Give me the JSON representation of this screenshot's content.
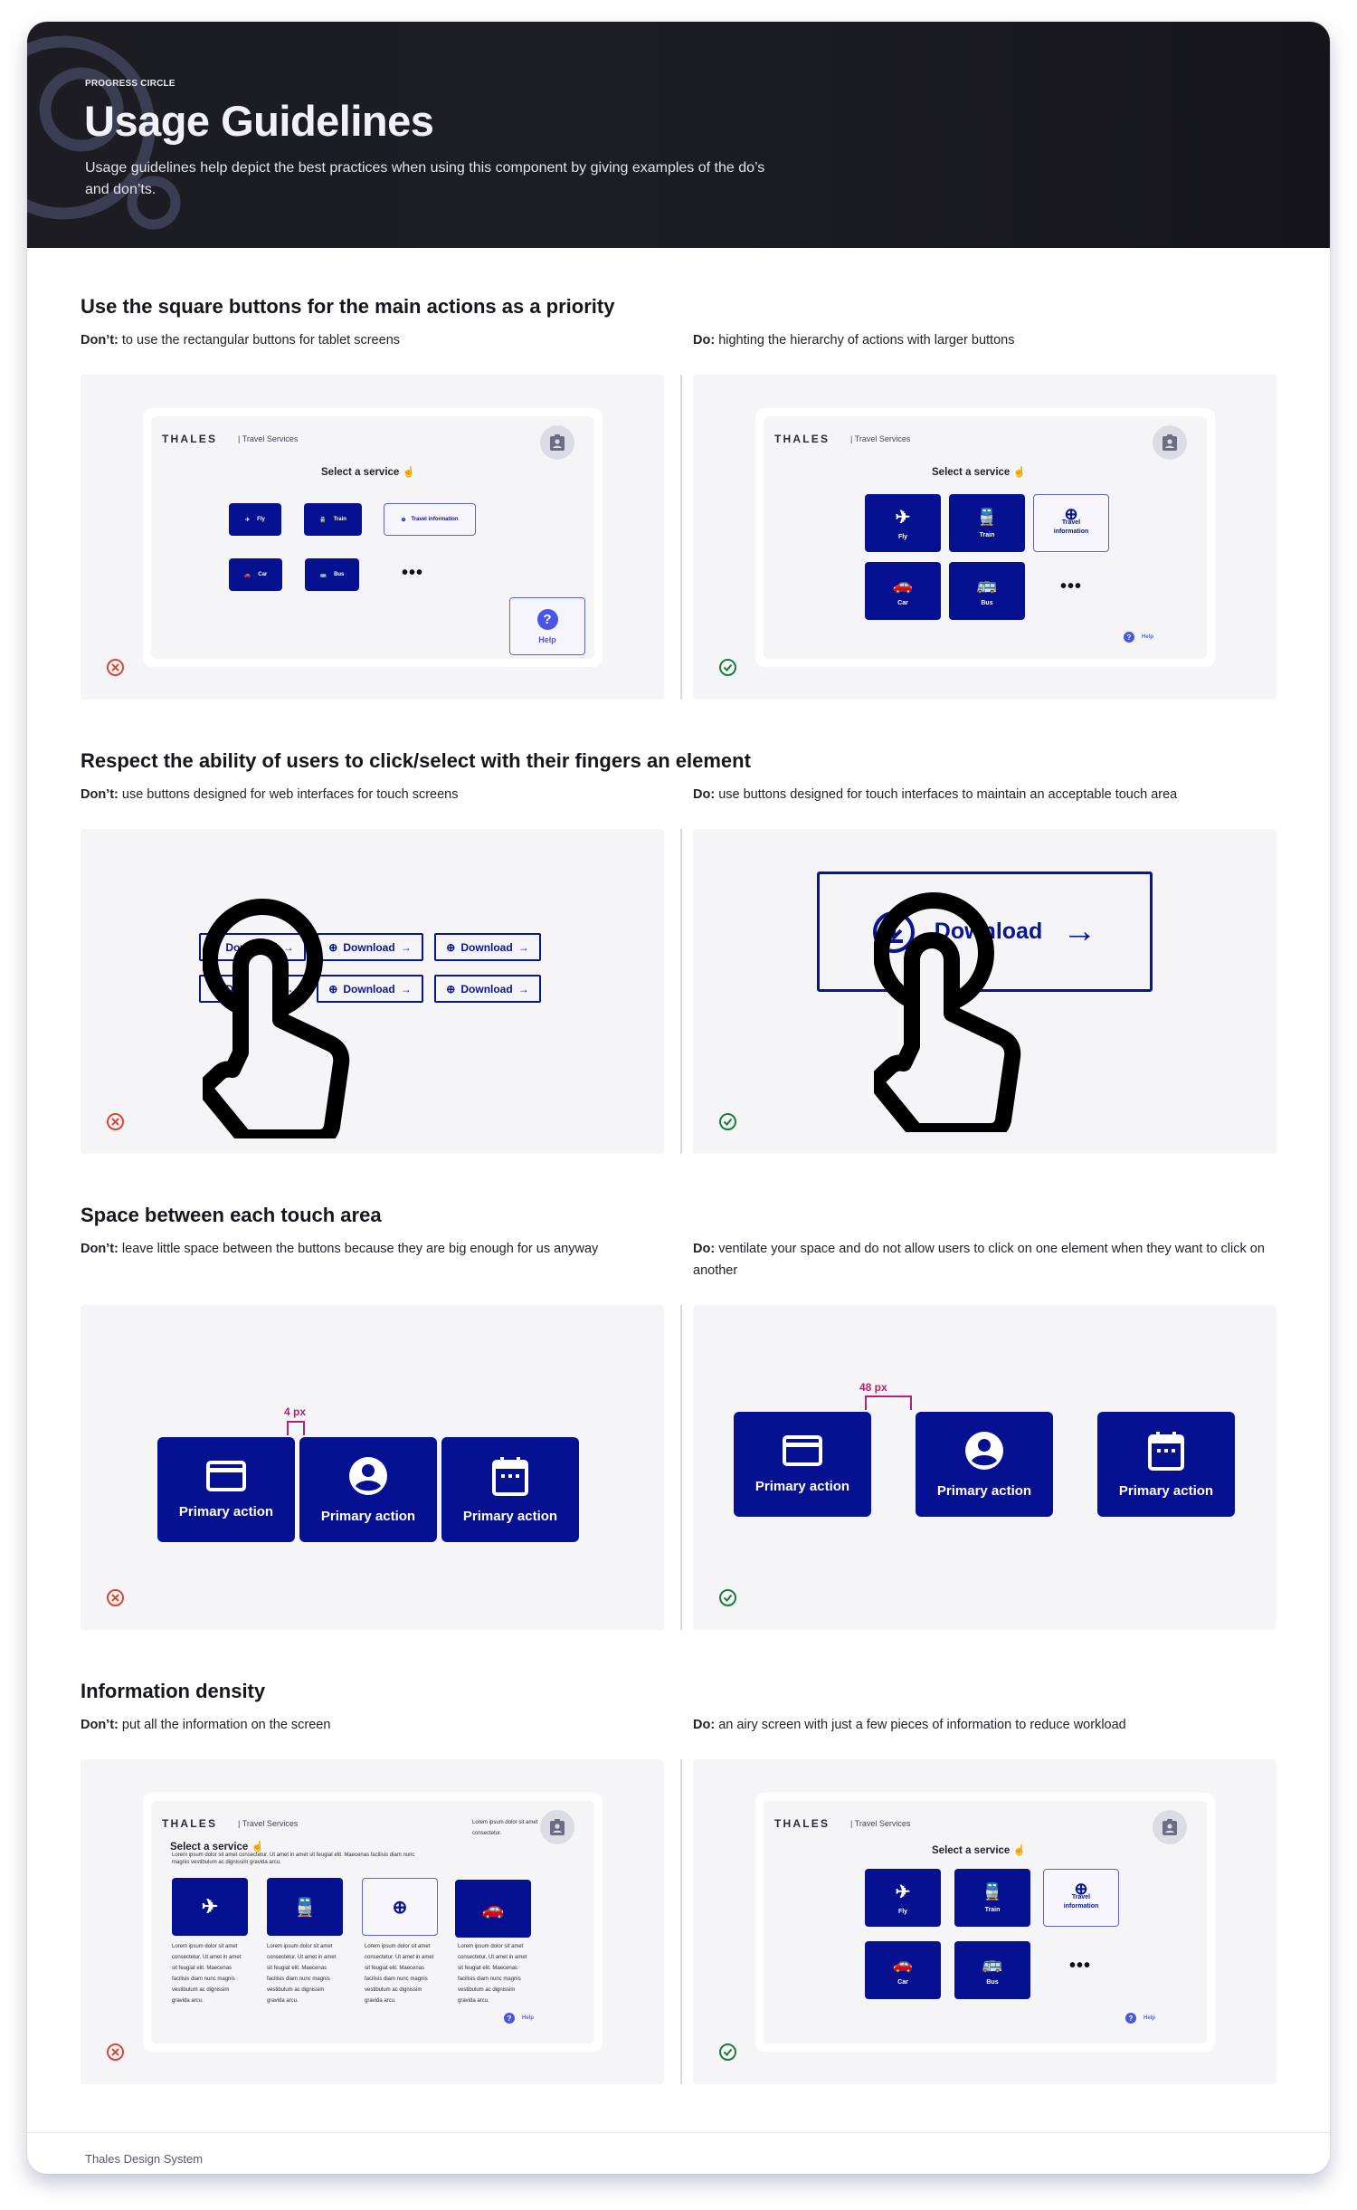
{
  "header": {
    "eyebrow": "PROGRESS CIRCLE",
    "title": "Usage Guidelines",
    "subtitle": "Usage guidelines help depict the best practices when using this component by giving examples of the do’s and don’ts."
  },
  "colors": {
    "brand_blue": "#051190",
    "dont_red": "#e0442e",
    "do_green": "#1c7a3e",
    "measure": "#b0246e",
    "help_blue": "#4a55e6"
  },
  "mock": {
    "brand": "THALES",
    "brand_sub": "Travel Services",
    "select_title": "Select a service",
    "services": [
      "Fly",
      "Train",
      "Travel information",
      "Car",
      "Bus"
    ],
    "travel_info_split": [
      "Travel",
      "information"
    ],
    "more": "•••",
    "help": "Help",
    "help_glyph": "?",
    "lorem_short": "Lorem ipsum dolor sit amet consectetur.",
    "lorem_intro": "Lorem ipsum dolor sit amet consectetur. Ut amet in amet sit feugiat elit. Maecenas facilisis diam nunc magnis vestibulum ac dignissim gravida arcu.",
    "lorem_card": "Lorem ipsum dolor sit amet consectetur. Ut amet in amet sit feugiat elit. Maecenas facilisis diam nunc magnis vestibulum ac dignissim gravida arcu."
  },
  "sections": [
    {
      "title": "Use the square buttons for the main actions as a priority",
      "dont_label": "Don’t:",
      "dont_text": " to use the rectangular buttons for tablet screens",
      "do_label": "Do:",
      "do_text": " highting the hierarchy of actions with larger buttons"
    },
    {
      "title": "Respect the ability of users to click/select with their fingers an element",
      "dont_label": "Don’t:",
      "dont_text": " use buttons designed for web interfaces for touch screens",
      "do_label": "Do:",
      "do_text": " use buttons designed for touch interfaces to maintain an acceptable touch area",
      "download_label": "Download",
      "small_buttons_count": 6
    },
    {
      "title": "Space between each touch area",
      "dont_label": "Don’t:",
      "dont_text": " leave little space between the buttons because they are big enough for us anyway",
      "do_label": "Do:",
      "do_text": " ventilate your space and do not allow users to click on one element when they want to click on another",
      "action_label": "Primary action",
      "dont_gap": "4 px",
      "do_gap": "48 px"
    },
    {
      "title": "Information density",
      "dont_label": "Don’t:",
      "dont_text": " put all the information on the screen",
      "do_label": "Do:",
      "do_text": " an airy screen with just a few pieces of information to reduce workload"
    }
  ],
  "footer": {
    "text": "Thales Design System"
  }
}
